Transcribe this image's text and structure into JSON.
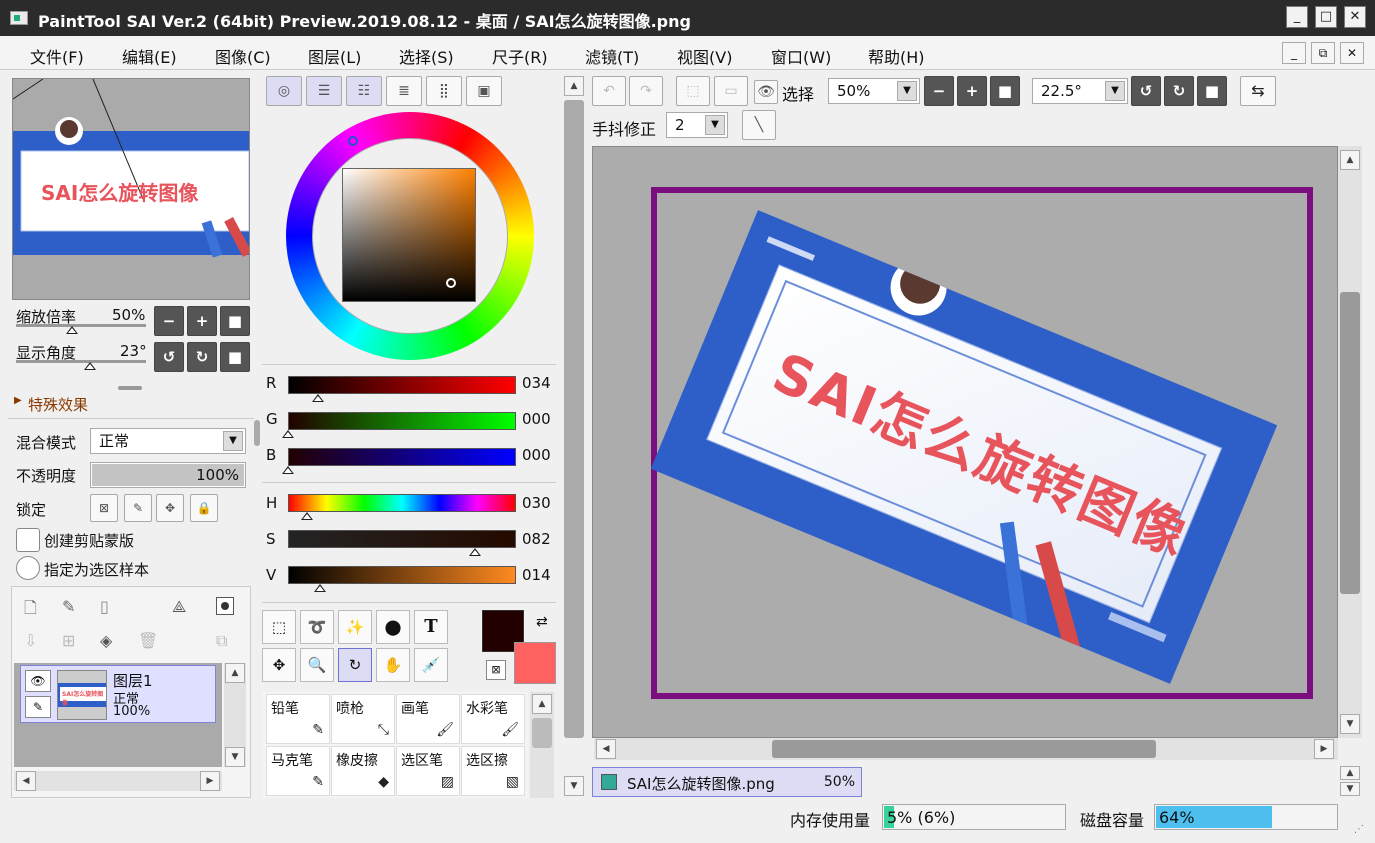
{
  "window": {
    "title": "PaintTool SAI Ver.2 (64bit) Preview.2019.08.12 - 桌面 / SAI怎么旋转图像.png",
    "minimize": "_",
    "maximize": "□",
    "close": "✕"
  },
  "menu": [
    "文件(F)",
    "编辑(E)",
    "图像(C)",
    "图层(L)",
    "选择(S)",
    "尺子(R)",
    "滤镜(T)",
    "视图(V)",
    "窗口(W)",
    "帮助(H)"
  ],
  "navigator": {
    "zoom_label": "缩放倍率",
    "zoom_value": "50%",
    "angle_label": "显示角度",
    "angle_value": "23°",
    "thumb_text": "SAI怎么旋转图像"
  },
  "effects": {
    "label": "特殊效果"
  },
  "layer_props": {
    "blend_label": "混合模式",
    "blend_value": "正常",
    "opacity_label": "不透明度",
    "opacity_value": "100%",
    "opacity_fraction": 1.0,
    "lock_label": "锁定",
    "clip_label": "创建剪贴蒙版",
    "sample_label": "指定为选区样本"
  },
  "layers": [
    {
      "name": "图层1",
      "mode": "正常",
      "opacity": "100%",
      "thumb_text": "SAI怎么旋转图像"
    }
  ],
  "color": {
    "rgb": [
      {
        "label": "R",
        "value": "034",
        "fraction": 0.133
      },
      {
        "label": "G",
        "value": "000",
        "fraction": 0.0
      },
      {
        "label": "B",
        "value": "000",
        "fraction": 0.0
      }
    ],
    "hsv": [
      {
        "label": "H",
        "value": "030",
        "fraction": 0.083
      },
      {
        "label": "S",
        "value": "082",
        "fraction": 0.82
      },
      {
        "label": "V",
        "value": "014",
        "fraction": 0.14
      }
    ],
    "primary": "#220000",
    "secondary": "#ff6060"
  },
  "brushes": [
    {
      "label": "铅笔",
      "icon": "pencil-icon"
    },
    {
      "label": "喷枪",
      "icon": "airbrush-icon"
    },
    {
      "label": "画笔",
      "icon": "brush-icon"
    },
    {
      "label": "水彩笔",
      "icon": "watercolor-icon"
    },
    {
      "label": "马克笔",
      "icon": "marker-icon"
    },
    {
      "label": "橡皮擦",
      "icon": "eraser-icon"
    },
    {
      "label": "选区笔",
      "icon": "select-pen-icon"
    },
    {
      "label": "选区擦",
      "icon": "select-eraser-icon"
    }
  ],
  "toolbar": {
    "select_label": "选择",
    "zoom_value": "50%",
    "angle_value": "22.5°",
    "stabilizer_label": "手抖修正",
    "stabilizer_value": "2"
  },
  "canvas": {
    "text": "SAI怎么旋转图像",
    "accent": "#7a0e7e"
  },
  "document_tab": {
    "name": "SAI怎么旋转图像.png",
    "zoom": "50%"
  },
  "status": {
    "memory_label": "内存使用量",
    "memory_value": "5% (6%)",
    "memory_fraction": 0.05,
    "disk_label": "磁盘容量",
    "disk_value": "64%",
    "disk_fraction": 0.64
  }
}
